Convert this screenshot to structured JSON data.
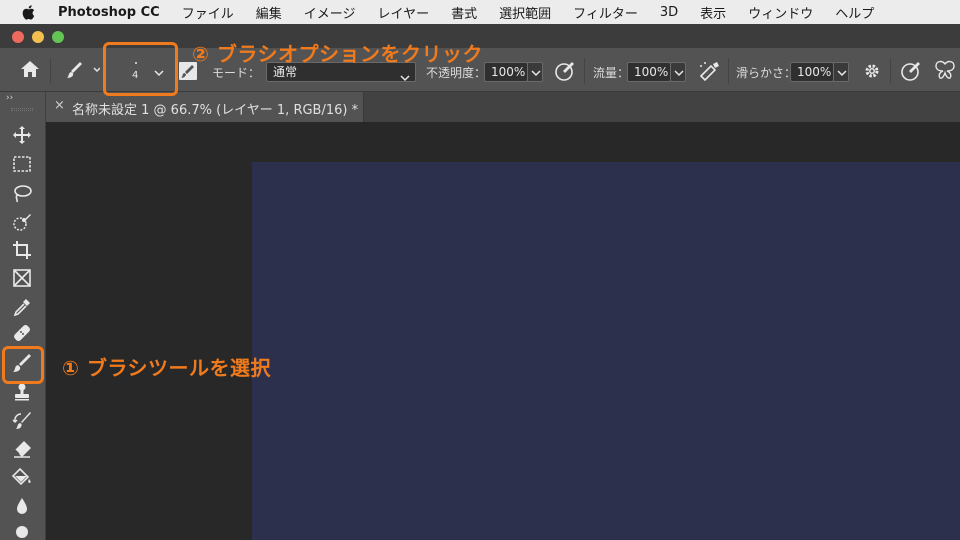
{
  "menubar": {
    "app_name": "Photoshop CC",
    "items": [
      "ファイル",
      "編集",
      "イメージ",
      "レイヤー",
      "書式",
      "選択範囲",
      "フィルター",
      "3D",
      "表示",
      "ウィンドウ",
      "ヘルプ"
    ]
  },
  "options": {
    "brush_size": "4",
    "mode_label": "モード：",
    "mode_value": "通常",
    "opacity_label": "不透明度：",
    "opacity_value": "100%",
    "flow_label": "流量：",
    "flow_value": "100%",
    "smoothing_label": "滑らかさ：",
    "smoothing_value": "100%"
  },
  "document": {
    "tab_close": "×",
    "tab_title": "名称未設定 1 @ 66.7% (レイヤー 1, RGB/16) *"
  },
  "annotations": {
    "step1": "① ブラシツールを選択",
    "step2": "② ブラシオプションをクリック"
  },
  "colors": {
    "accent": "#f07a1c",
    "canvas": "#2d304d",
    "toolbar": "#535353",
    "menubar": "#ececec"
  },
  "icons": {
    "toolbar": [
      "move-icon",
      "marquee-icon",
      "lasso-icon",
      "quick-select-icon",
      "crop-icon",
      "frame-icon",
      "eyedropper-icon",
      "healing-icon",
      "brush-icon",
      "stamp-icon",
      "history-brush-icon",
      "eraser-icon",
      "paint-bucket-icon",
      "blur-icon",
      "dodge-icon"
    ]
  }
}
